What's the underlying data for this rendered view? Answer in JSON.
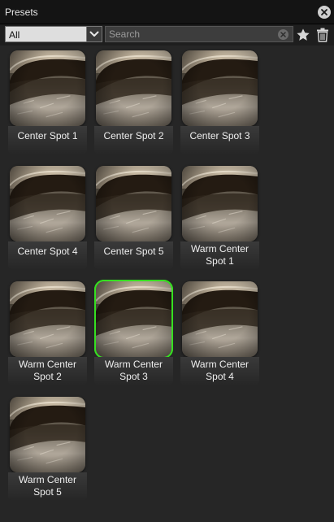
{
  "panel": {
    "title": "Presets"
  },
  "toolbar": {
    "filter_value": "All",
    "search_placeholder": "Search",
    "search_value": ""
  },
  "colors": {
    "selected_outline": "#36e021",
    "background": "#262626"
  },
  "presets": [
    {
      "name": "Center Spot 1",
      "selected": false
    },
    {
      "name": "Center Spot 2",
      "selected": false
    },
    {
      "name": "Center Spot 3",
      "selected": false
    },
    {
      "name": "Center Spot 4",
      "selected": false
    },
    {
      "name": "Center Spot 5",
      "selected": false
    },
    {
      "name": "Warm Center Spot 1",
      "selected": false
    },
    {
      "name": "Warm Center Spot 2",
      "selected": false
    },
    {
      "name": "Warm Center Spot 3",
      "selected": true
    },
    {
      "name": "Warm Center Spot 4",
      "selected": false
    },
    {
      "name": "Warm Center Spot 5",
      "selected": false
    }
  ]
}
